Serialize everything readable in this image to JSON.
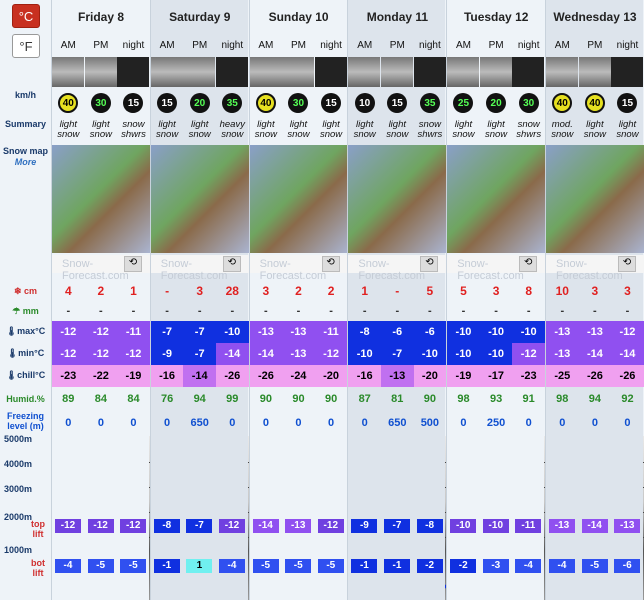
{
  "units": {
    "celsius": "°C",
    "fahrenheit": "°F"
  },
  "labels": {
    "wind": "km/h",
    "summary": "Summary",
    "snowmap": "Snow map",
    "more": "More",
    "snow": "cm",
    "rain": "mm",
    "max": "max°C",
    "min": "min°C",
    "chill": "chill°C",
    "humid": "Humid.%",
    "freezing": "Freezing level (m)",
    "h5000": "5000m",
    "h4000": "4000m",
    "h3000": "3000m",
    "h2000": "2000m",
    "h1000": "1000m",
    "toplift": "top lift",
    "botlift": "bot lift"
  },
  "watermark": "Snow-Forecast.com",
  "colors": {
    "max_dark": "#1030e0",
    "max_light": "#9050f0",
    "chill": "#f0a0f0",
    "chill_hi": "#c070f0"
  },
  "days": [
    {
      "name": "Friday 8",
      "periods": [
        "AM",
        "PM",
        "night"
      ],
      "wind": [
        "40",
        "30",
        "15"
      ],
      "summary": [
        [
          "light",
          "snow"
        ],
        [
          "light",
          "snow"
        ],
        [
          "snow",
          "shwrs"
        ]
      ],
      "snow": [
        "4",
        "2",
        "1"
      ],
      "rain": [
        "-",
        "-",
        "-"
      ],
      "max": [
        "-12",
        "-12",
        "-11"
      ],
      "min": [
        "-12",
        "-12",
        "-12"
      ],
      "chill": [
        "-23",
        "-22",
        "-19"
      ],
      "humid": [
        "89",
        "84",
        "84"
      ],
      "frz": [
        "0",
        "0",
        "0"
      ],
      "top": [
        "-12",
        "-12",
        "-12"
      ],
      "bot": [
        "-4",
        "-5",
        "-5"
      ]
    },
    {
      "name": "Saturday 9",
      "periods": [
        "AM",
        "PM",
        "night"
      ],
      "wind": [
        "15",
        "20",
        "35"
      ],
      "summary": [
        [
          "light",
          "snow"
        ],
        [
          "light",
          "snow"
        ],
        [
          "heavy",
          "snow"
        ]
      ],
      "snow": [
        "-",
        "3",
        "28"
      ],
      "rain": [
        "-",
        "-",
        "-"
      ],
      "max": [
        "-7",
        "-7",
        "-10"
      ],
      "min": [
        "-9",
        "-7",
        "-14"
      ],
      "chill": [
        "-16",
        "-14",
        "-26"
      ],
      "humid": [
        "76",
        "94",
        "99"
      ],
      "frz": [
        "0",
        "650",
        "0"
      ],
      "top": [
        "-8",
        "-7",
        "-12"
      ],
      "bot": [
        "-1",
        "1",
        "-4"
      ]
    },
    {
      "name": "Sunday 10",
      "periods": [
        "AM",
        "PM",
        "night"
      ],
      "wind": [
        "40",
        "30",
        "15"
      ],
      "summary": [
        [
          "light",
          "snow"
        ],
        [
          "light",
          "snow"
        ],
        [
          "light",
          "snow"
        ]
      ],
      "snow": [
        "3",
        "2",
        "2"
      ],
      "rain": [
        "-",
        "-",
        "-"
      ],
      "max": [
        "-13",
        "-13",
        "-11"
      ],
      "min": [
        "-14",
        "-13",
        "-12"
      ],
      "chill": [
        "-26",
        "-24",
        "-20"
      ],
      "humid": [
        "90",
        "90",
        "90"
      ],
      "frz": [
        "0",
        "0",
        "0"
      ],
      "top": [
        "-14",
        "-13",
        "-12"
      ],
      "bot": [
        "-5",
        "-5",
        "-5"
      ]
    },
    {
      "name": "Monday 11",
      "periods": [
        "AM",
        "PM",
        "night"
      ],
      "wind": [
        "10",
        "15",
        "35"
      ],
      "summary": [
        [
          "light",
          "snow"
        ],
        [
          "light",
          "snow"
        ],
        [
          "snow",
          "shwrs"
        ]
      ],
      "snow": [
        "1",
        "-",
        "5"
      ],
      "rain": [
        "-",
        "-",
        "-"
      ],
      "max": [
        "-8",
        "-6",
        "-6"
      ],
      "min": [
        "-10",
        "-7",
        "-10"
      ],
      "chill": [
        "-16",
        "-13",
        "-20"
      ],
      "humid": [
        "87",
        "81",
        "90"
      ],
      "frz": [
        "0",
        "650",
        "500"
      ],
      "top": [
        "-9",
        "-7",
        "-8"
      ],
      "bot": [
        "-1",
        "-1",
        "-2"
      ]
    },
    {
      "name": "Tuesday 12",
      "periods": [
        "AM",
        "PM",
        "night"
      ],
      "wind": [
        "25",
        "20",
        "30"
      ],
      "summary": [
        [
          "light",
          "snow"
        ],
        [
          "light",
          "snow"
        ],
        [
          "snow",
          "shwrs"
        ]
      ],
      "snow": [
        "5",
        "3",
        "8"
      ],
      "rain": [
        "-",
        "-",
        "-"
      ],
      "max": [
        "-10",
        "-10",
        "-10"
      ],
      "min": [
        "-10",
        "-10",
        "-12"
      ],
      "chill": [
        "-19",
        "-17",
        "-23"
      ],
      "humid": [
        "98",
        "93",
        "91"
      ],
      "frz": [
        "0",
        "250",
        "0"
      ],
      "top": [
        "-10",
        "-10",
        "-11"
      ],
      "bot": [
        "-2",
        "-3",
        "-4"
      ]
    },
    {
      "name": "Wednesday 13",
      "periods": [
        "AM",
        "PM",
        "night"
      ],
      "wind": [
        "40",
        "40",
        "15"
      ],
      "summary": [
        [
          "mod.",
          "snow"
        ],
        [
          "light",
          "snow"
        ],
        [
          "light",
          "snow"
        ]
      ],
      "snow": [
        "10",
        "3",
        "3"
      ],
      "rain": [
        "-",
        "-",
        "-"
      ],
      "max": [
        "-13",
        "-13",
        "-12"
      ],
      "min": [
        "-13",
        "-14",
        "-14"
      ],
      "chill": [
        "-25",
        "-26",
        "-26"
      ],
      "humid": [
        "98",
        "94",
        "92"
      ],
      "frz": [
        "0",
        "0",
        "0"
      ],
      "top": [
        "-13",
        "-14",
        "-13"
      ],
      "bot": [
        "-4",
        "-5",
        "-6"
      ]
    }
  ]
}
